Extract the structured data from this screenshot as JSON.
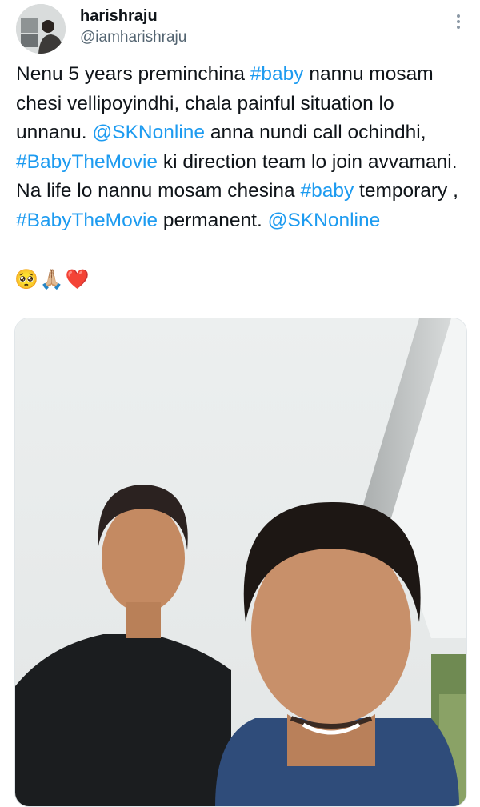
{
  "tweet": {
    "display_name": "harishraju",
    "handle": "@iamharishraju",
    "more_icon": "more-vertical-icon",
    "segments": [
      {
        "text": "Nenu 5 years preminchina ",
        "type": "text"
      },
      {
        "text": "#baby",
        "type": "hashtag"
      },
      {
        "text": " nannu mosam chesi vellipoyindhi, chala painful situation lo unnanu. ",
        "type": "text"
      },
      {
        "text": "@SKNonline",
        "type": "mention"
      },
      {
        "text": " anna nundi call ochindhi, ",
        "type": "text"
      },
      {
        "text": "#BabyTheMovie",
        "type": "hashtag"
      },
      {
        "text": " ki direction team lo join avvamani. Na life lo nannu mosam chesina ",
        "type": "text"
      },
      {
        "text": "#baby",
        "type": "hashtag"
      },
      {
        "text": " temporary , ",
        "type": "text"
      },
      {
        "text": "#BabyTheMovie",
        "type": "hashtag"
      },
      {
        "text": " permanent. ",
        "type": "text"
      },
      {
        "text": "@SKNonline",
        "type": "mention"
      }
    ],
    "emojis": "🥺🙏🏼❤️"
  },
  "colors": {
    "link": "#1d9bf0",
    "text": "#0f1419",
    "secondary": "#536471"
  }
}
